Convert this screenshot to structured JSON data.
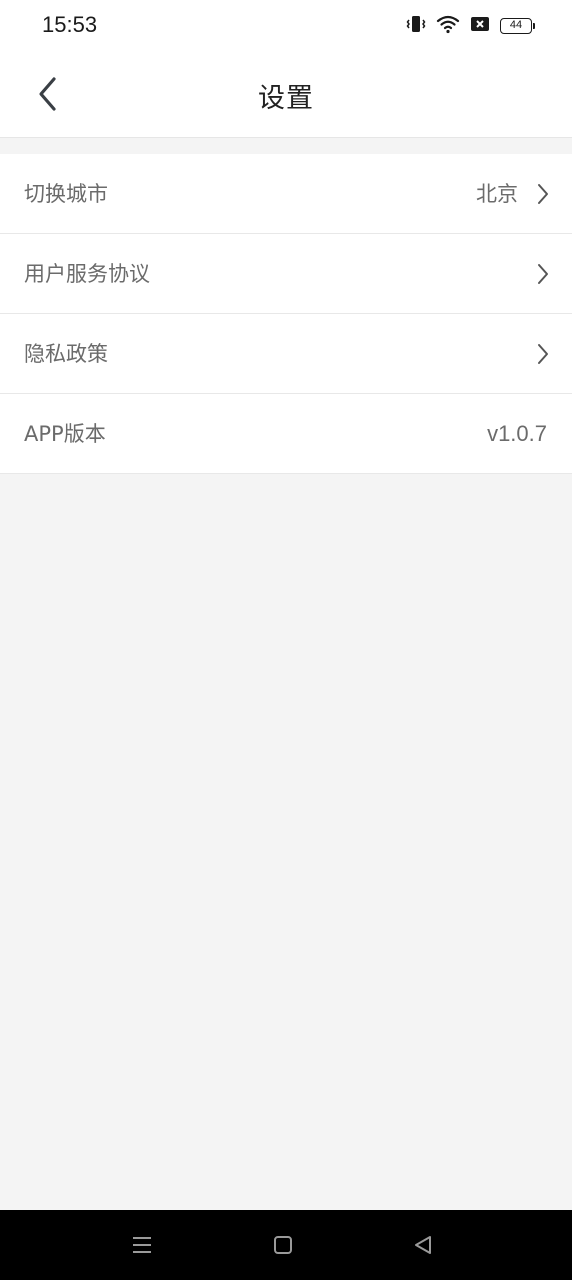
{
  "status_bar": {
    "time": "15:53",
    "battery": "44",
    "icons": [
      "vibrate-icon",
      "wifi-icon",
      "no-sim-icon",
      "battery-icon"
    ]
  },
  "header": {
    "title": "设置",
    "back_icon": "chevron-left-icon"
  },
  "settings": {
    "items": [
      {
        "label": "切换城市",
        "value": "北京",
        "has_arrow": true
      },
      {
        "label": "用户服务协议",
        "value": "",
        "has_arrow": true
      },
      {
        "label": "隐私政策",
        "value": "",
        "has_arrow": true
      },
      {
        "label": "APP版本",
        "value": "v1.0.7",
        "has_arrow": false
      }
    ]
  },
  "system_nav": {
    "buttons": [
      "menu-icon",
      "home-icon",
      "back-triangle-icon"
    ]
  },
  "colors": {
    "background": "#f4f4f4",
    "surface": "#ffffff",
    "text_primary": "#222222",
    "text_secondary": "#6b6b6b",
    "divider": "#e8e8e8",
    "system_bar": "#000000"
  }
}
